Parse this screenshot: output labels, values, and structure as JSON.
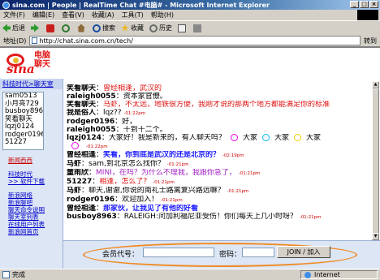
{
  "window": {
    "title": "sina.com | People | RealTime Chat #电脑# - Microsoft Internet Explorer"
  },
  "menu": [
    "文件(F)",
    "编辑(E)",
    "查看(V)",
    "收藏(A)",
    "工具(T)",
    "帮助(H)"
  ],
  "toolbar": {
    "back": "后退",
    "search": "搜索",
    "favorites": "收藏",
    "history": "历史"
  },
  "address": {
    "label": "地址(D)",
    "url": "http://chat.sina.com.cn/tech/",
    "go": "转到"
  },
  "logo": {
    "text": "sina",
    "brand_line1": "电脑",
    "brand_line2": "聊天"
  },
  "sidebar": {
    "tabs": "科技时代>聊天室",
    "users": [
      "sam0513",
      "小月亮729",
      "busboy8963",
      "笑看聊天",
      "lqzj0124",
      "rodger0196",
      "51227"
    ],
    "links_red": [
      "新闻西西",
      "科技时代",
      ">> 软件下载"
    ],
    "links": [
      "新浪网络",
      "新浪聊吧",
      "聊天命令说明",
      "聊天室列表",
      "在线用户列表",
      "新浪网首页"
    ]
  },
  "chat": {
    "messages": [
      {
        "nick": "笑看聊天",
        "sep": "：",
        "text": "曾经相逢，武汉的",
        "color": "red",
        "time": ""
      },
      {
        "nick": "raleigh0055",
        "sep": "：",
        "text": "资本家官僚。",
        "color": "black",
        "time": ""
      },
      {
        "nick": "笑看聊天",
        "sep": "：",
        "text": "马虾，不太远，地铁很方便，我刚才说的那两个地方都能满足你的标准",
        "color": "red",
        "time": ""
      },
      {
        "nick": "我是俗人",
        "sep": "：",
        "text": "lqz??",
        "color": "black",
        "time": "-01:22pm"
      },
      {
        "nick": "rodger0196",
        "sep": "：",
        "text": "好，",
        "color": "black",
        "time": ""
      },
      {
        "nick": "raleigh0055",
        "sep": "：",
        "text": "十到十二个。",
        "color": "black",
        "time": ""
      },
      {
        "nick": "lqzj0124",
        "sep": "：",
        "text": "大家好！我是新来的，有人聊天吗？",
        "color": "black",
        "time": "",
        "trail": "大家"
      },
      {
        "nick": "",
        "sep": "",
        "text": "",
        "color": "black",
        "time": "-01:22pm"
      },
      {
        "nick": "曾经相逢",
        "sep": "：",
        "text": "笑看，你到底是武汉的还是北京的？",
        "color": "blue",
        "time": "-02:19pm"
      },
      {
        "nick": "马虾",
        "sep": "：",
        "text": "sam,到北京怎么找你？",
        "color": "black",
        "time": "-01:21pm"
      },
      {
        "nick": "童雨欣",
        "sep": "：",
        "text": "MINI，在吗？为什么不理我，我跟你急了，",
        "color": "purple",
        "time": "-01:21pm"
      },
      {
        "nick": "51227",
        "sep": "：",
        "text": "相逢，怎么了？",
        "color": "red",
        "time": "-01:21pm"
      },
      {
        "nick": "马虾",
        "sep": "：",
        "text": "聊天,谢谢,你说的南礼士路离复兴路远嘛？",
        "color": "black",
        "time": "-01:21pm"
      },
      {
        "nick": "rodger0196",
        "sep": "：",
        "text": "欢迎加入！",
        "color": "black",
        "time": "-01:21pm"
      },
      {
        "nick": "曾经相逢",
        "sep": "：",
        "text": "那家伙，让我见了有他的好看",
        "color": "blue",
        "time": ""
      },
      {
        "nick": "busboy8963",
        "sep": "：",
        "text": "RALEIGH:问加利福尼亚受伤！你们每天上几小时呀？",
        "color": "black",
        "time": "-01:21pm"
      }
    ],
    "smiley_caption": "大家"
  },
  "join": {
    "member_label": "会员代号：",
    "member_value": "",
    "password_label": "密码：",
    "password_value": "",
    "button": "JOIN / 加入"
  },
  "status": {
    "left": "完成",
    "zone": "Internet"
  }
}
